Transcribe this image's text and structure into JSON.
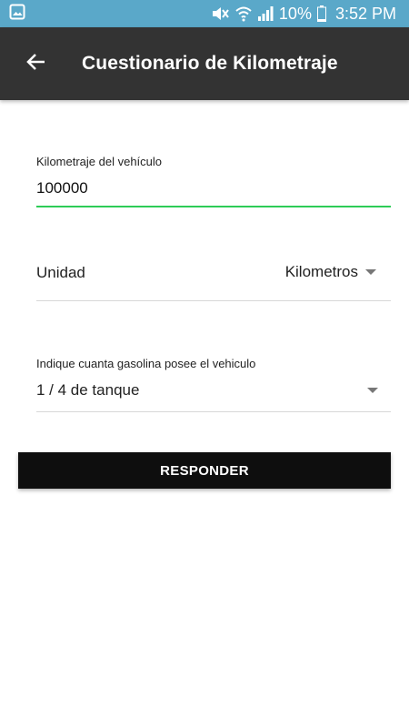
{
  "status_bar": {
    "battery": "10%",
    "time": "3:52 PM",
    "icons": [
      "image-icon",
      "mute-icon",
      "wifi-icon",
      "signal-icon",
      "battery-icon"
    ]
  },
  "app_bar": {
    "title": "Cuestionario de Kilometraje",
    "back_icon": "arrow-left-icon"
  },
  "form": {
    "mileage": {
      "label": "Kilometraje del vehículo",
      "value": "100000"
    },
    "unit": {
      "label": "Unidad",
      "selected": "Kilometros"
    },
    "fuel": {
      "label": "Indique cuanta gasolina posee el vehiculo",
      "selected": "1 / 4 de tanque"
    },
    "submit_label": "RESPONDER"
  },
  "colors": {
    "status_bar": "#5aa8c9",
    "app_bar": "#333333",
    "active_underline": "#2ecc57",
    "button": "#0e0e0e"
  }
}
